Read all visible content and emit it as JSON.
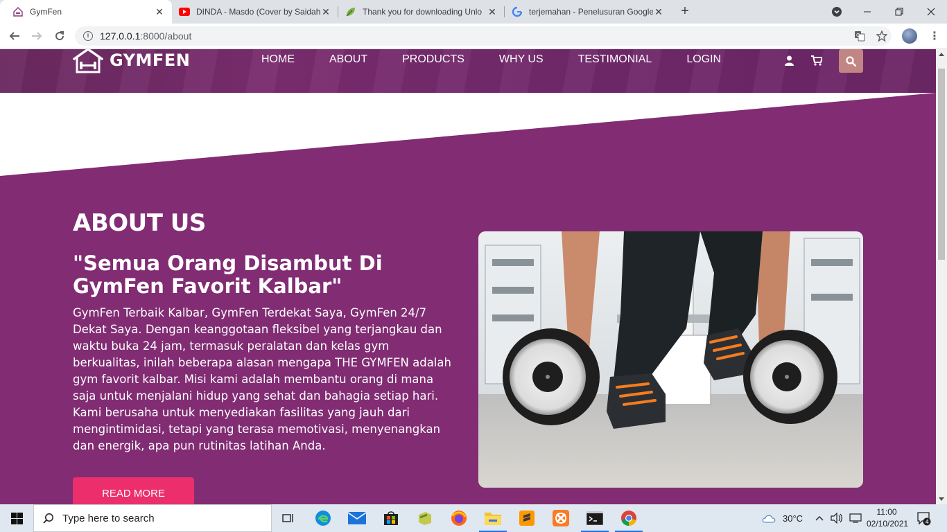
{
  "browser": {
    "tabs": [
      {
        "title": "GymFen",
        "icon": "gym-house-icon",
        "active": true
      },
      {
        "title": "DINDA - Masdo (Cover by Saidah",
        "icon": "youtube-icon",
        "active": false
      },
      {
        "title": "Thank you for downloading Unlo",
        "icon": "leaf-icon",
        "active": false
      },
      {
        "title": "terjemahan - Penelusuran Google",
        "icon": "google-icon",
        "active": false
      }
    ],
    "url_host": "127.0.0.1",
    "url_path": ":8000/about"
  },
  "site": {
    "brand": "GYMFEN",
    "nav": [
      "HOME",
      "ABOUT",
      "PRODUCTS",
      "WHY US",
      "TESTIMONIAL",
      "LOGIN"
    ],
    "colors": {
      "primary": "#812c73",
      "header": "#72296a",
      "accent": "#ec2f6c",
      "search": "#c18583"
    }
  },
  "about": {
    "title": "ABOUT US",
    "quote": "\"Semua Orang Disambut Di GymFen Favorit Kalbar\"",
    "body": "GymFen Terbaik Kalbar, GymFen Terdekat Saya, GymFen 24/7 Dekat Saya. Dengan keanggotaan fleksibel yang terjangkau dan waktu buka 24 jam, termasuk peralatan dan kelas gym berkualitas, inilah beberapa alasan mengapa THE GYMFEN adalah gym favorit kalbar. Misi kami adalah membantu orang di mana saja untuk menjalani hidup yang sehat dan bahagia setiap hari. Kami berusaha untuk menyediakan fasilitas yang jauh dari mengintimidasi, tetapi yang terasa memotivasi, menyenangkan dan energik, apa pun rutinitas latihan Anda.",
    "button": "READ MORE"
  },
  "taskbar": {
    "search_placeholder": "Type here to search",
    "weather": "30°C",
    "time": "11:00",
    "date": "02/10/2021",
    "notifications": "4"
  }
}
